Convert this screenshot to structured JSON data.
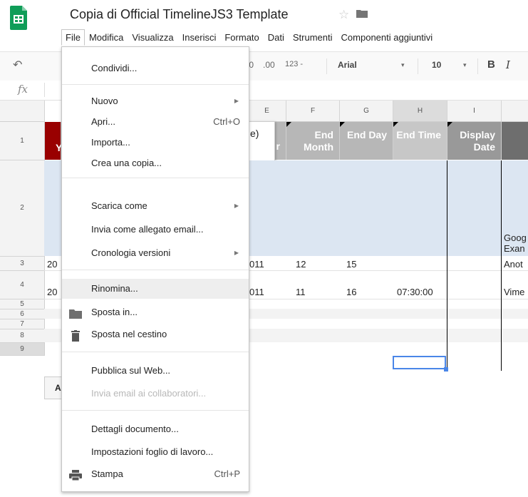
{
  "header": {
    "title": "Copia di Official TimelineJS3 Template",
    "menus": [
      "File",
      "Modifica",
      "Visualizza",
      "Inserisci",
      "Formato",
      "Dati",
      "Strumenti",
      "Componenti aggiuntivi"
    ]
  },
  "toolbar": {
    "dec_decimals": ".0",
    "inc_decimals": ".00",
    "number_format": "123 -",
    "font": "Arial",
    "font_size": "10",
    "bold": "B",
    "italic": "I"
  },
  "formula": {
    "fx": "fx"
  },
  "grid": {
    "columns": [
      "E",
      "F",
      "G",
      "H",
      "I"
    ],
    "rows": [
      "1",
      "2",
      "3",
      "4",
      "5",
      "6",
      "7",
      "8",
      "9"
    ],
    "headers": {
      "e_frag": "r",
      "end_month": "End Month",
      "end_day": "End Day",
      "end_time": "End Time",
      "display_date": "Display Date",
      "first_col": "Y"
    },
    "paren_frag": "e)",
    "row3": {
      "a": "20",
      "e": "011",
      "f": "12",
      "g": "15",
      "j": "Anot"
    },
    "row4": {
      "a": "20",
      "e": "011",
      "f": "11",
      "g": "16",
      "h": "07:30:00",
      "j": "Vime"
    },
    "row2": {
      "j1": "Goog",
      "j2": "Exan"
    },
    "bottom_frag": "A"
  },
  "file_menu": {
    "items": [
      {
        "label": "Condividi..."
      },
      {
        "label": "Nuovo",
        "submenu": true
      },
      {
        "label": "Apri...",
        "shortcut": "Ctrl+O"
      },
      {
        "label": "Importa..."
      },
      {
        "label": "Crea una copia..."
      },
      {
        "label": "Scarica come",
        "submenu": true
      },
      {
        "label": "Invia come allegato email..."
      },
      {
        "label": "Cronologia versioni",
        "submenu": true
      },
      {
        "label": "Rinomina..."
      },
      {
        "label": "Sposta in...",
        "icon": "folder-icon"
      },
      {
        "label": "Sposta nel cestino",
        "icon": "trash-icon"
      },
      {
        "label": "Pubblica sul Web..."
      },
      {
        "label": "Invia email ai collaboratori..."
      },
      {
        "label": "Dettagli documento..."
      },
      {
        "label": "Impostazioni foglio di lavoro..."
      },
      {
        "label": "Stampa",
        "shortcut": "Ctrl+P",
        "icon": "printer-icon"
      }
    ],
    "highlighted": "Rinomina...",
    "disabled": "Invia email ai collaboratori..."
  },
  "colors": {
    "accent_green": "#0f9d58",
    "header_grey": "#b7b7b7",
    "header_red": "#990000",
    "row2_blue": "#dce6f2",
    "selection_blue": "#1a73e8"
  }
}
